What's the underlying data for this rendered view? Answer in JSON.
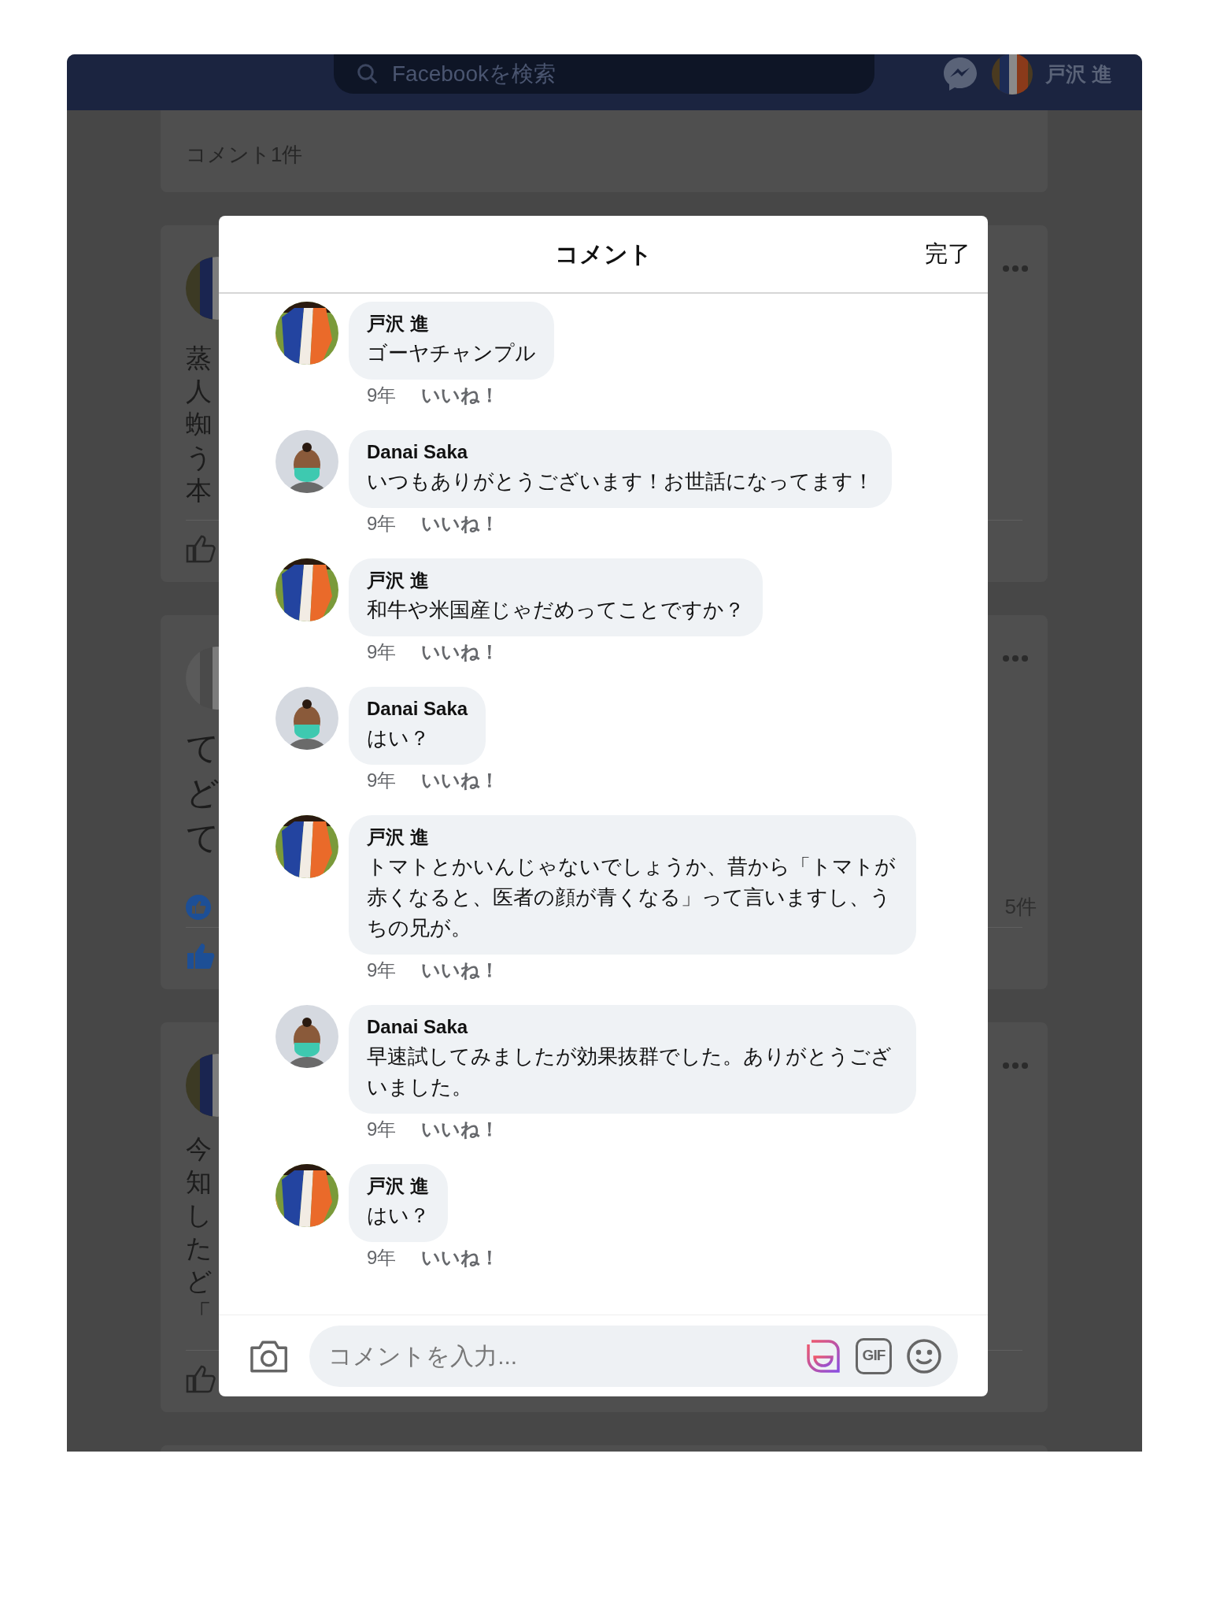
{
  "top_bar": {
    "search": {
      "placeholder": "Facebookを検索"
    },
    "user_name": "戸沢 進"
  },
  "background_posts": [
    {
      "comment_count": "コメント1件"
    },
    {
      "lines": [
        "蒸",
        "人",
        "蜘",
        "う",
        "本"
      ],
      "liked": false
    },
    {
      "lines": [
        "て",
        "ど",
        "て"
      ],
      "reaction_count": "5件",
      "liked": true
    },
    {
      "lines": [
        "今",
        "知",
        "し",
        "た",
        "ど",
        "「"
      ],
      "liked": false
    }
  ],
  "dialog": {
    "title": "コメント",
    "done": "完了",
    "comments": [
      {
        "author": "戸沢 進",
        "kind": "photo",
        "text": "ゴーヤチャンプル",
        "time": "9年",
        "like": "いいね！"
      },
      {
        "author": "Danai Saka",
        "kind": "character",
        "text": "いつもありがとうございます！お世話になってます！",
        "time": "9年",
        "like": "いいね！"
      },
      {
        "author": "戸沢 進",
        "kind": "photo",
        "text": "和牛や米国産じゃだめってことですか？",
        "time": "9年",
        "like": "いいね！"
      },
      {
        "author": "Danai Saka",
        "kind": "character",
        "text": "はい？",
        "time": "9年",
        "like": "いいね！"
      },
      {
        "author": "戸沢 進",
        "kind": "photo",
        "text": "トマトとかいんじゃないでしょうか、昔から「トマトが赤くなると、医者の顔が青くなる」って言いますし、うちの兄が。",
        "time": "9年",
        "like": "いいね！"
      },
      {
        "author": "Danai Saka",
        "kind": "character",
        "text": "早速試してみましたが効果抜群でした。ありがとうございました。",
        "time": "9年",
        "like": "いいね！"
      },
      {
        "author": "戸沢 進",
        "kind": "photo",
        "text": "はい？",
        "time": "9年",
        "like": "いいね！"
      }
    ],
    "input": {
      "placeholder": "コメントを入力...",
      "gif_label": "GIF"
    }
  }
}
